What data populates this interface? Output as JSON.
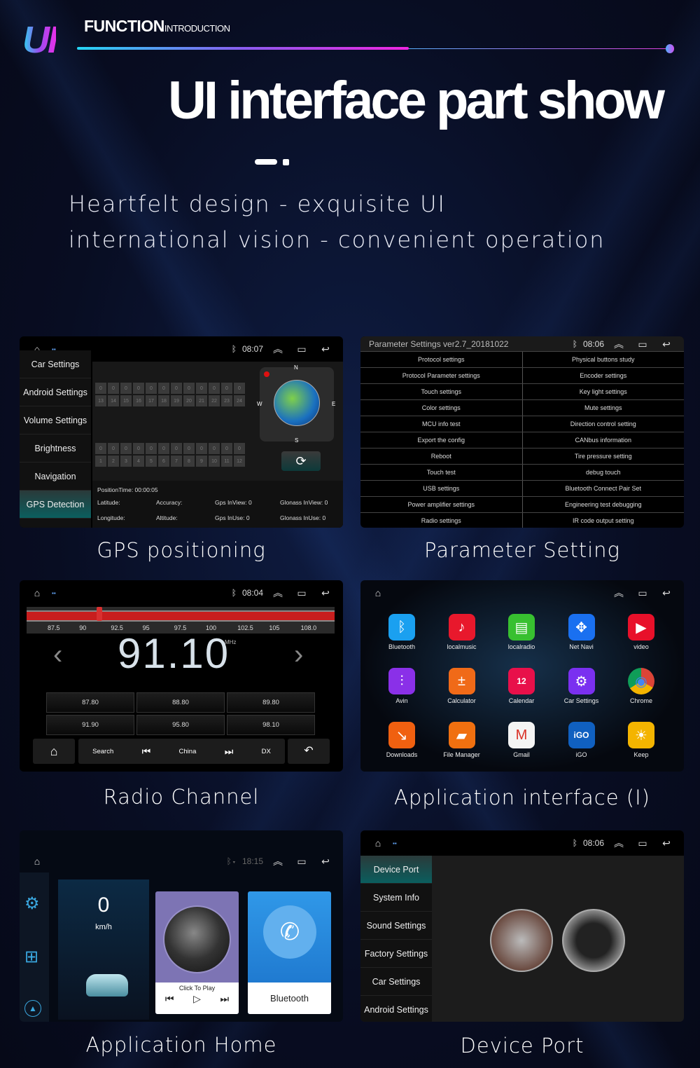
{
  "header": {
    "logo": "UI",
    "function": "FUNCTION",
    "introduction": "INTRODUCTION",
    "title": "UI interface part show",
    "tagline1": "Heartfelt design - exquisite UI",
    "tagline2": "international vision - convenient operation"
  },
  "captions": {
    "gps": "GPS positioning",
    "param": "Parameter Setting",
    "radio": "Radio Channel",
    "apps": "Application interface (I)",
    "home": "Application Home",
    "device": "Device Port"
  },
  "gps": {
    "time": "08:07",
    "sidebar": [
      "Car Settings",
      "Android Settings",
      "Volume Settings",
      "Brightness",
      "Navigation",
      "GPS Detection"
    ],
    "selected": "GPS Detection",
    "row_top_values": [
      "0",
      "0",
      "0",
      "0",
      "0",
      "0",
      "0",
      "0",
      "0",
      "0",
      "0",
      "0"
    ],
    "row_top_ids": [
      "13",
      "14",
      "15",
      "16",
      "17",
      "18",
      "19",
      "20",
      "21",
      "22",
      "23",
      "24"
    ],
    "row_bottom_values": [
      "0",
      "0",
      "0",
      "0",
      "0",
      "0",
      "0",
      "0",
      "0",
      "0",
      "0",
      "0"
    ],
    "row_bottom_ids": [
      "1",
      "2",
      "3",
      "4",
      "5",
      "6",
      "7",
      "8",
      "9",
      "10",
      "11",
      "12"
    ],
    "compass": [
      "N",
      "S",
      "W",
      "E"
    ],
    "position_time": "PositionTime: 00:00:05",
    "latitude": "Latitude:",
    "accuracy": "Accuracy:",
    "gps_inview": "Gps InView: 0",
    "glonass_inview": "Glonass InView: 0",
    "longitude": "Longitude:",
    "altitude": "Altitude:",
    "gps_inuse": "Gps InUse: 0",
    "glonass_inuse": "Glonass InUse: 0"
  },
  "param": {
    "title": "Parameter Settings ver2.7_20181022",
    "time": "08:06",
    "rows": [
      [
        "Protocol settings",
        "Physical buttons study"
      ],
      [
        "Protocol Parameter settings",
        "Encoder settings"
      ],
      [
        "Touch settings",
        "Key light settings"
      ],
      [
        "Color settings",
        "Mute settings"
      ],
      [
        "MCU info test",
        "Direction control setting"
      ],
      [
        "Export the config",
        "CANbus information"
      ],
      [
        "Reboot",
        "Tire pressure setting"
      ],
      [
        "Touch test",
        "debug touch"
      ],
      [
        "USB settings",
        "Bluetooth Connect Pair Set"
      ],
      [
        "Power amplifier settings",
        "Engineering test debugging"
      ],
      [
        "Radio settings",
        "IR code output setting"
      ]
    ]
  },
  "radio": {
    "time": "08:04",
    "scale": [
      "87.5",
      "90",
      "92.5",
      "95",
      "97.5",
      "100",
      "102.5",
      "105",
      "108.0"
    ],
    "frequency": "91.10",
    "unit": "MHz",
    "tuner_position_mhz": 91.1,
    "presets": [
      "87.80",
      "88.80",
      "89.80",
      "91.90",
      "95.80",
      "98.10"
    ],
    "search": "Search",
    "band": "China",
    "dx": "DX"
  },
  "apps": {
    "items": [
      {
        "label": "Bluetooth",
        "color": "#1aa0f0",
        "glyph": "ᛒ"
      },
      {
        "label": "localmusic",
        "color": "#e8182c",
        "glyph": "♪"
      },
      {
        "label": "localradio",
        "color": "#38c030",
        "glyph": "▤"
      },
      {
        "label": "Net Navi",
        "color": "#1a70f0",
        "glyph": "✥"
      },
      {
        "label": "video",
        "color": "#e8102a",
        "glyph": "▶"
      },
      {
        "label": "Avin",
        "color": "#8a30e8",
        "glyph": "⫶"
      },
      {
        "label": "Calculator",
        "color": "#f06a18",
        "glyph": "±"
      },
      {
        "label": "Calendar",
        "color": "#e8104a",
        "glyph": "12"
      },
      {
        "label": "Car Settings",
        "color": "#7a30f0",
        "glyph": "⚙"
      },
      {
        "label": "Chrome",
        "color": "#e0e0e0",
        "glyph": "◉"
      },
      {
        "label": "Downloads",
        "color": "#f06010",
        "glyph": "↘"
      },
      {
        "label": "File Manager",
        "color": "#f07010",
        "glyph": "▰"
      },
      {
        "label": "Gmail",
        "color": "#f4f4f4",
        "glyph": "M"
      },
      {
        "label": "iGO",
        "color": "#1060c0",
        "glyph": "iGO"
      },
      {
        "label": "Keep",
        "color": "#f4b400",
        "glyph": "☀"
      }
    ]
  },
  "home": {
    "time": "18:15",
    "speed": "0",
    "speed_unit": "km/h",
    "music": "Click To Play",
    "bluetooth": "Bluetooth"
  },
  "device": {
    "time": "08:06",
    "sidebar": [
      "Device Port",
      "System Info",
      "Sound Settings",
      "Factory Settings",
      "Car Settings",
      "Android Settings"
    ],
    "selected": "Device Port"
  },
  "colors": {
    "accent_cyan": "#25d6f5",
    "accent_magenta": "#f025e0",
    "selected_teal": "#0b5e5e",
    "radio_red": "#c81e1e",
    "music_card": "#7d74b4",
    "bluetooth_card": "#2a8de0"
  }
}
